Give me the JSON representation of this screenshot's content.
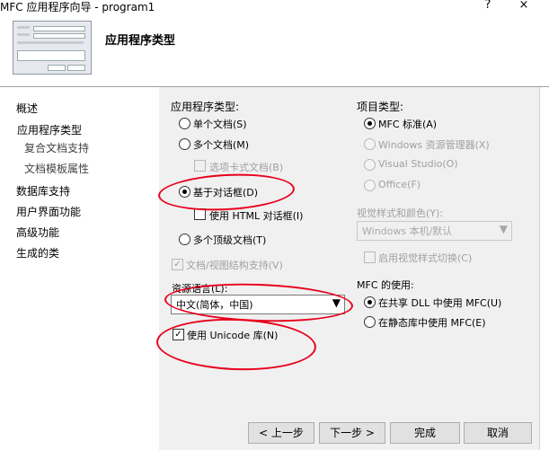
{
  "window": {
    "title": "MFC 应用程序向导 - program1",
    "controls": [
      "?",
      "×"
    ]
  },
  "header": {
    "title": "应用程序类型"
  },
  "nav": {
    "items": [
      {
        "label": "概述",
        "sub": false
      },
      {
        "label": "应用程序类型",
        "sub": false
      },
      {
        "label": "复合文档支持",
        "sub": true
      },
      {
        "label": "文档模板属性",
        "sub": true
      },
      {
        "label": "数据库支持",
        "sub": false
      },
      {
        "label": "用户界面功能",
        "sub": false
      },
      {
        "label": "高级功能",
        "sub": false
      },
      {
        "label": "生成的类",
        "sub": false
      }
    ]
  },
  "app_type": {
    "heading": "应用程序类型:",
    "single": "单个文档(S)",
    "multi": "多个文档(M)",
    "tabbed": "选项卡式文档(B)",
    "dialog": "基于对话框(D)",
    "html_dialog": "使用 HTML 对话框(I)",
    "multi_top": "多个顶级文档(T)",
    "docview": "文档/视图结构支持(V)",
    "selected": "dialog"
  },
  "language": {
    "label": "资源语言(L):",
    "value": "中文(简体，中国)"
  },
  "unicode": {
    "label": "使用 Unicode 库(N)",
    "checked": true
  },
  "project_type": {
    "heading": "项目类型:",
    "options": [
      "MFC 标准(A)",
      "Windows 资源管理器(X)",
      "Visual Studio(O)",
      "Office(F)"
    ],
    "selected": 0
  },
  "visual_style": {
    "label": "视觉样式和颜色(Y):",
    "value": "Windows 本机/默认",
    "toggle": "启用视觉样式切换(C)"
  },
  "mfc_use": {
    "heading": "MFC 的使用:",
    "shared": "在共享 DLL 中使用 MFC(U)",
    "static": "在静态库中使用 MFC(E)",
    "selected": "shared"
  },
  "buttons": {
    "prev": "< 上一步",
    "next": "下一步 >",
    "finish": "完成",
    "cancel": "取消"
  },
  "colors": {
    "annotation": "#e8001c",
    "panel": "#f0f0f0"
  }
}
